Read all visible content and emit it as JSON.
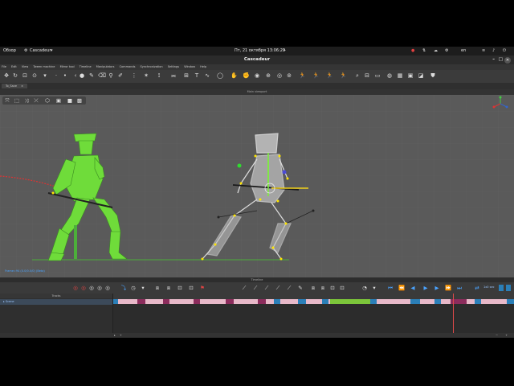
{
  "gnome": {
    "activities": "Обзор",
    "app_menu": "Cascadeur",
    "clock": "Пт, 21 октября  13:06:29",
    "keyboard": "en"
  },
  "app": {
    "title": "Cascadeur",
    "menu": [
      "File",
      "Edit",
      "View",
      "Tween machine",
      "Mirror tool",
      "Timeline",
      "Manipulators",
      "Commands",
      "Synchronization",
      "Settings",
      "Window",
      "Help"
    ],
    "tab": "To_Save",
    "viewport_label": "Main viewport",
    "viewport_status": "Frame=94 (0.0/0.0/0) (Beta)",
    "timeline_label": "Timeline",
    "tracks_title": "Tracks",
    "track_name": "Scene",
    "frame_readout": "1x0 sec"
  },
  "colors": {
    "accent": "#4aa3ff",
    "green_character": "#6fdc3a",
    "playhead": "#e24a4a",
    "key_pink": "#e8b9c9",
    "key_purple": "#8c2c5c",
    "key_blue": "#2b7fb8",
    "key_green": "#7cc63a"
  },
  "icons": {
    "toolbar": [
      "move-icon",
      "rotate-icon",
      "scale-icon",
      "select-icon",
      "point-icon",
      "point-icon",
      "brush-icon",
      "eraser-icon",
      "pin-icon",
      "figure-icon",
      "joint-icon",
      "chain-icon",
      "lock-icon",
      "curve-icon",
      "spline-icon",
      "text-icon",
      "rect-icon",
      "lasso-icon",
      "fist-icon",
      "hand-icon",
      "ik-icon",
      "head-icon",
      "gear-icon",
      "physics-icon",
      "run-icon",
      "run-icon",
      "run-icon",
      "run-icon",
      "search-icon",
      "frame-icon",
      "grid-icon",
      "sphere-icon",
      "world-icon",
      "cube-icon",
      "cube-icon",
      "shield-icon"
    ]
  }
}
